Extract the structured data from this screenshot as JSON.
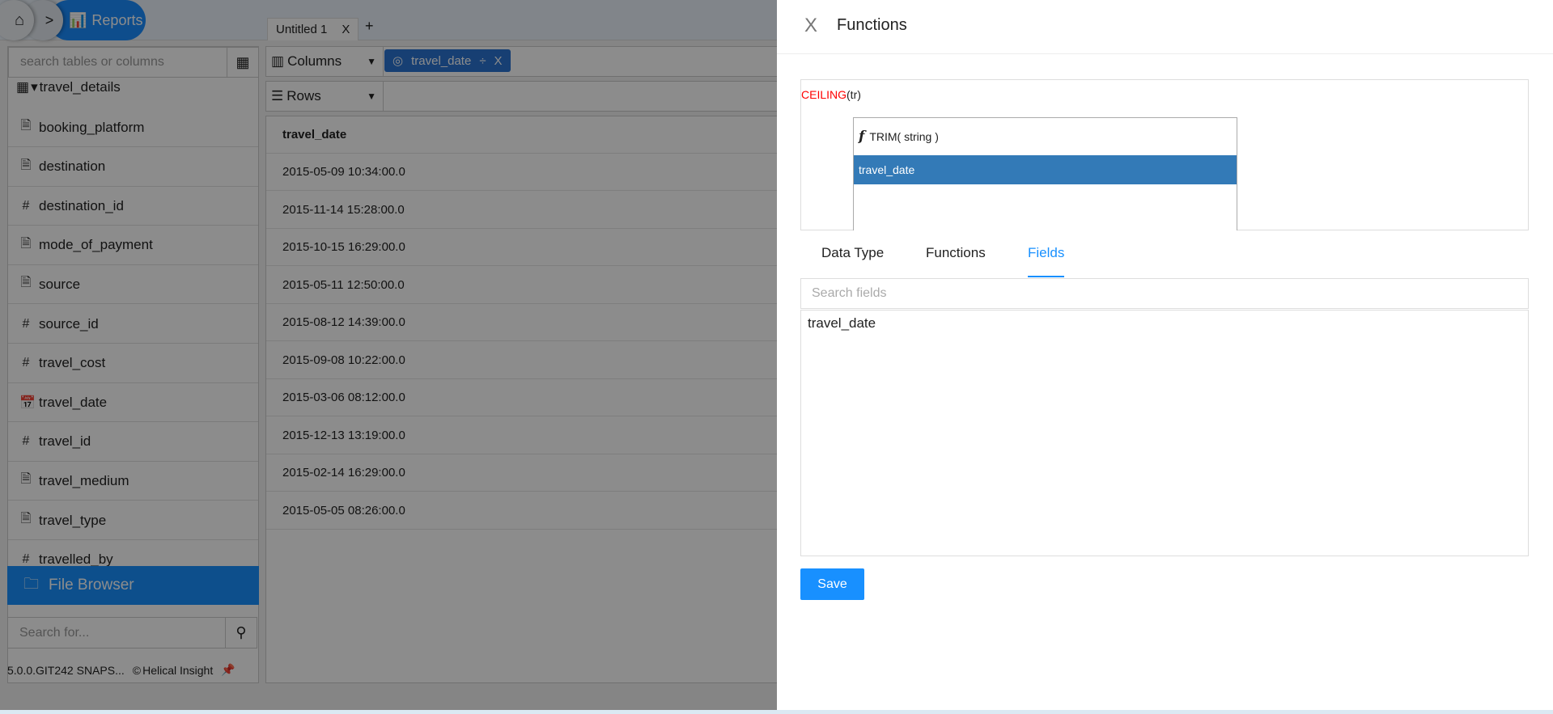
{
  "breadcrumb": {
    "home_icon": "home-icon",
    "separator": ">",
    "current": "Reports"
  },
  "sidebar": {
    "search_placeholder": "search tables or columns",
    "table_name": "travel_details",
    "items": [
      {
        "label": "booking_platform",
        "icon": "text-file-icon"
      },
      {
        "label": "destination",
        "icon": "text-file-icon"
      },
      {
        "label": "destination_id",
        "icon": "hash-icon"
      },
      {
        "label": "mode_of_payment",
        "icon": "text-file-icon"
      },
      {
        "label": "source",
        "icon": "text-file-icon"
      },
      {
        "label": "source_id",
        "icon": "hash-icon"
      },
      {
        "label": "travel_cost",
        "icon": "hash-icon"
      },
      {
        "label": "travel_date",
        "icon": "calendar-icon"
      },
      {
        "label": "travel_id",
        "icon": "hash-icon"
      },
      {
        "label": "travel_medium",
        "icon": "text-file-icon"
      },
      {
        "label": "travel_type",
        "icon": "text-file-icon"
      },
      {
        "label": "travelled_by",
        "icon": "hash-icon"
      }
    ],
    "file_browser": "File Browser",
    "search_for_placeholder": "Search for...",
    "version": "5.0.0.GIT242 SNAPS...",
    "brand": "Helical Insight"
  },
  "report": {
    "tab": "Untitled 1",
    "tab_close": "X",
    "add_tab": "+",
    "columns_label": "Columns",
    "rows_label": "Rows",
    "column_pill": "travel_date",
    "pill_close": "X",
    "grid": {
      "header": "travel_date",
      "rows": [
        "2015-05-09 10:34:00.0",
        "2015-11-14 15:28:00.0",
        "2015-10-15 16:29:00.0",
        "2015-05-11 12:50:00.0",
        "2015-08-12 14:39:00.0",
        "2015-09-08 10:22:00.0",
        "2015-03-06 08:12:00.0",
        "2015-12-13 13:19:00.0",
        "2015-02-14 16:29:00.0",
        "2015-05-05 08:26:00.0"
      ]
    }
  },
  "panel": {
    "close": "X",
    "title": "Functions",
    "expression": {
      "function": "CEILING",
      "args": "(tr)"
    },
    "autocomplete": {
      "function_icon": "f",
      "function_item": "TRIM( string )",
      "selected_item": "travel_date"
    },
    "tabs": [
      "Data Type",
      "Functions",
      "Fields"
    ],
    "active_tab": "Fields",
    "search_placeholder": "Search fields",
    "fields": [
      "travel_date"
    ],
    "save": "Save"
  },
  "colors": {
    "accent": "#1890ff",
    "selected": "#337ab7",
    "function": "#ff0000"
  }
}
